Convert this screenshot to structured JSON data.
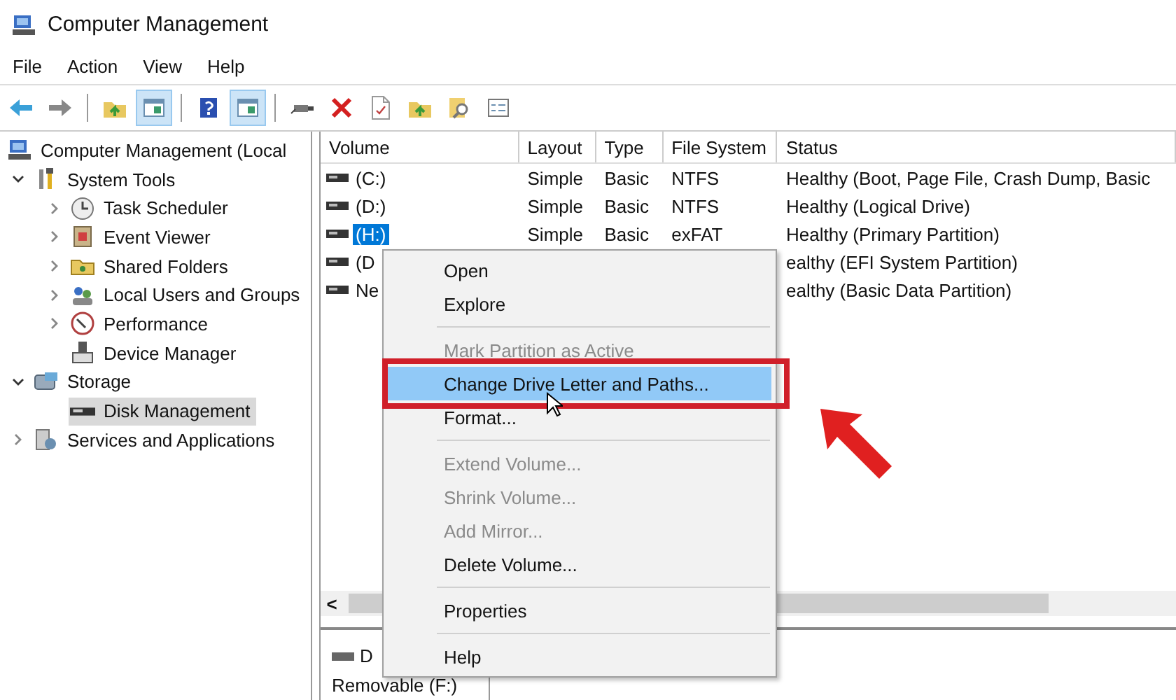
{
  "window": {
    "title": "Computer Management"
  },
  "menu_bar": [
    "File",
    "Action",
    "View",
    "Help"
  ],
  "toolbar": [
    {
      "pressed": false
    },
    {
      "pressed": false
    },
    {
      "pressed": false
    },
    {
      "pressed": true
    },
    {
      "pressed": false
    },
    {
      "pressed": true
    },
    {
      "pressed": false
    },
    {
      "pressed": false
    },
    {
      "pressed": false
    },
    {
      "pressed": false
    },
    {
      "pressed": false
    },
    {
      "pressed": false
    }
  ],
  "tree": [
    {
      "label": "Computer Management (Local",
      "selected": false,
      "children": [
        {
          "label": "System Tools",
          "expanded": true,
          "selected": false,
          "children": [
            {
              "label": "Task Scheduler",
              "expanded": false,
              "selected": false
            },
            {
              "label": "Event Viewer",
              "expanded": false,
              "selected": false
            },
            {
              "label": "Shared Folders",
              "expanded": false,
              "selected": false
            },
            {
              "label": "Local Users and Groups",
              "expanded": false,
              "selected": false
            },
            {
              "label": "Performance",
              "expanded": false,
              "selected": false
            },
            {
              "label": "Device Manager",
              "selected": false
            }
          ]
        },
        {
          "label": "Storage",
          "expanded": true,
          "selected": false,
          "children": [
            {
              "label": "Disk Management",
              "selected": true
            }
          ]
        },
        {
          "label": "Services and Applications",
          "expanded": false,
          "selected": false
        }
      ]
    }
  ],
  "table": {
    "columns": [
      "Volume",
      "Layout",
      "Type",
      "File System",
      "Status"
    ],
    "rows": [
      {
        "cells": [
          "(C:)",
          "Simple",
          "Basic",
          "NTFS",
          "Healthy (Boot, Page File, Crash Dump, Basic"
        ],
        "selected": false
      },
      {
        "cells": [
          "(D:)",
          "Simple",
          "Basic",
          "NTFS",
          "Healthy (Logical Drive)"
        ],
        "selected": false
      },
      {
        "cells": [
          "(H:)",
          "Simple",
          "Basic",
          "exFAT",
          "Healthy (Primary Partition)"
        ],
        "selected": true
      },
      {
        "cells": [
          "(D",
          "",
          "",
          "",
          "ealthy (EFI System Partition)"
        ],
        "selected": false
      },
      {
        "cells": [
          "Ne",
          "",
          "",
          "",
          "ealthy (Basic Data Partition)"
        ],
        "selected": false
      }
    ]
  },
  "scrollbar": {
    "left_button": "<"
  },
  "disk_pane": {
    "name": "D",
    "type": "Removable (F:)"
  },
  "context_menu": [
    {
      "kind": "item",
      "label": "Open",
      "disabled": false,
      "selected": false
    },
    {
      "kind": "item",
      "label": "Explore",
      "disabled": false,
      "selected": false
    },
    {
      "kind": "separator"
    },
    {
      "kind": "item",
      "label": "Mark Partition as Active",
      "disabled": true,
      "selected": false
    },
    {
      "kind": "item",
      "label": "Change Drive Letter and Paths...",
      "disabled": false,
      "selected": true
    },
    {
      "kind": "item",
      "label": "Format...",
      "disabled": false,
      "selected": false
    },
    {
      "kind": "separator"
    },
    {
      "kind": "item",
      "label": "Extend Volume...",
      "disabled": true,
      "selected": false
    },
    {
      "kind": "item",
      "label": "Shrink Volume...",
      "disabled": true,
      "selected": false
    },
    {
      "kind": "item",
      "label": "Add Mirror...",
      "disabled": true,
      "selected": false
    },
    {
      "kind": "item",
      "label": "Delete Volume...",
      "disabled": false,
      "selected": false
    },
    {
      "kind": "separator"
    },
    {
      "kind": "item",
      "label": "Properties",
      "disabled": false,
      "selected": false
    },
    {
      "kind": "separator"
    },
    {
      "kind": "item",
      "label": "Help",
      "disabled": false,
      "selected": false
    }
  ]
}
